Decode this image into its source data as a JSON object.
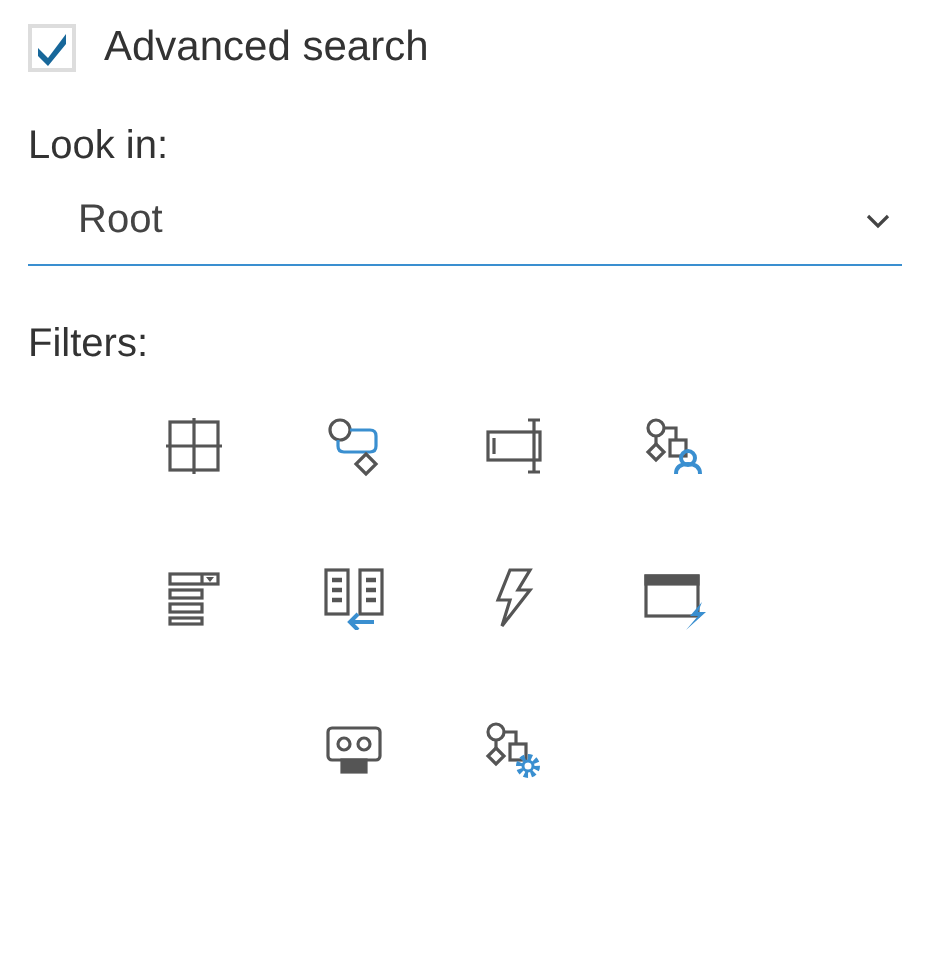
{
  "advanced_search": {
    "label": "Advanced search",
    "checked": true
  },
  "look_in": {
    "label": "Look in:",
    "value": "Root"
  },
  "filters": {
    "label": "Filters:",
    "items": [
      {
        "kind": "grid"
      },
      {
        "kind": "flow"
      },
      {
        "kind": "field"
      },
      {
        "kind": "workflow-user"
      },
      {
        "kind": "dropdown"
      },
      {
        "kind": "transfer"
      },
      {
        "kind": "lightning"
      },
      {
        "kind": "window-event"
      },
      {
        "kind": "robot"
      },
      {
        "kind": "workflow-settings"
      }
    ]
  }
}
